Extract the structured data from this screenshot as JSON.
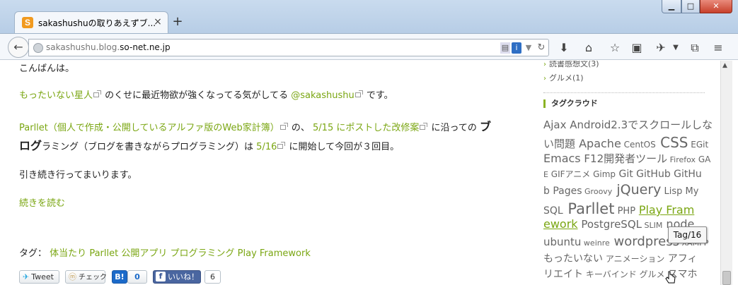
{
  "tab": {
    "title": "sakashushuの取りあえずブ...",
    "close": "×",
    "new_tab": "+"
  },
  "window": {
    "minimize": "▁",
    "maximize": "□",
    "close": "✕"
  },
  "navbar": {
    "url_prefix": "sakashushu.blog.",
    "url_domain": "so-net.ne.jp",
    "back": "←"
  },
  "post": {
    "greeting": "こんばんは。",
    "line2": {
      "link1": "もったいない星人",
      "mid": "のくせに最近物欲が強くなってる気がしてる",
      "link2": "@sakashushu",
      "end": "です。"
    },
    "line3": {
      "link1": "Parllet（個人で作成・公開しているアルファ版のWeb家計簿）",
      "mid": "の、",
      "link2": "5/15 にポストした改修案",
      "end": "に沿っての"
    },
    "line3_big": "ブ",
    "line4": {
      "big1": "ログ",
      "rest": "ラミング（ブログを書きながらプログラミング）は",
      "link": "5/16",
      "end": "に開始して今回が３回目。"
    },
    "line5": "引き続き行ってまいります。",
    "read_more": "続きを読む",
    "tags_label": "タグ：",
    "tags": [
      "体当たり",
      "Parllet",
      "公開アプリ",
      "プログラミング",
      "Play Framework"
    ]
  },
  "share": {
    "tweet": "Tweet",
    "check": "チェック",
    "hatena_count": "0",
    "like": "いいね！",
    "like_count": "6"
  },
  "sidebar": {
    "categories": [
      "読書感想文(3)",
      "グルメ(1)"
    ],
    "heading": "タグクラウド",
    "tooltip": "Tag/16",
    "cloud_lines": [
      [
        [
          "Ajax",
          15
        ],
        [
          " Android2.3でスクロールしな",
          15
        ]
      ],
      [
        [
          "い問題",
          15
        ],
        [
          " Apache",
          16
        ],
        [
          " CentOS",
          12
        ],
        [
          " CSS",
          20
        ],
        [
          " EGit",
          12
        ]
      ],
      [
        [
          "Emacs",
          16
        ],
        [
          " F12開発者ツール",
          15
        ],
        [
          " Firefox",
          11
        ],
        [
          " GA",
          12
        ]
      ],
      [
        [
          "E",
          11
        ],
        [
          " GIFアニメ",
          12
        ],
        [
          " Gimp",
          12
        ],
        [
          " Git",
          14
        ],
        [
          " GitHub",
          14
        ],
        [
          " GitHu",
          14
        ]
      ],
      [
        [
          "b Pages",
          14
        ],
        [
          " Groovy",
          11
        ],
        [
          " jQuery",
          19
        ],
        [
          " Lisp",
          13
        ],
        [
          " My",
          13
        ]
      ],
      [
        [
          "SQL",
          14
        ],
        [
          " Parllet",
          21
        ],
        [
          " PHP",
          13
        ],
        [
          " ",
          15
        ],
        [
          "Play Fram",
          16,
          true
        ]
      ],
      [
        [
          "ework",
          16,
          true
        ],
        [
          " PostgreSQL",
          15
        ],
        [
          " SLIM",
          11
        ],
        [
          " node",
          16
        ]
      ],
      [
        [
          "ubuntu",
          15
        ],
        [
          " weinre",
          11
        ],
        [
          " wordpress",
          18
        ],
        [
          " XAMPP",
          11
        ]
      ],
      [
        [
          "もったいない",
          14
        ],
        [
          " アニメーション",
          12
        ],
        [
          " アフィ",
          14
        ]
      ],
      [
        [
          "リエイト",
          14
        ],
        [
          " キーバインド",
          12
        ],
        [
          " グルメ",
          12
        ],
        [
          " スマホ",
          14
        ]
      ]
    ]
  },
  "colors": {
    "link": "#7aa612",
    "accent": "#8bb324"
  }
}
